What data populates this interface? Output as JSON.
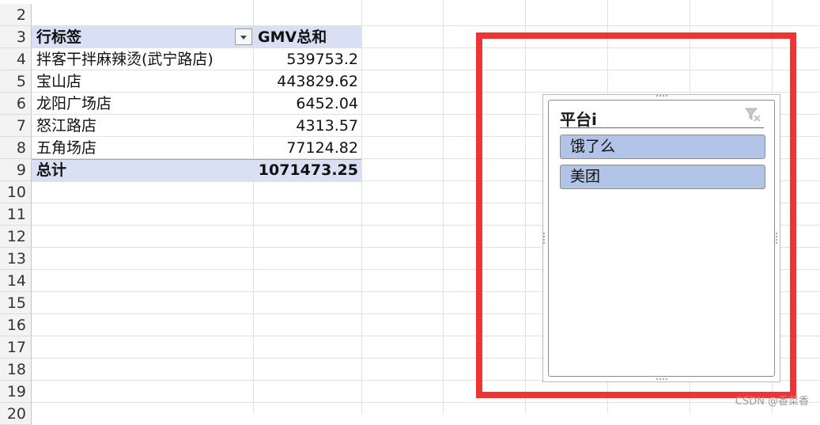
{
  "sheet": {
    "row_numbers": [
      "2",
      "3",
      "4",
      "5",
      "6",
      "7",
      "8",
      "9",
      "10",
      "11",
      "12",
      "13",
      "14",
      "15",
      "16",
      "17",
      "18",
      "19",
      "20"
    ]
  },
  "pivot": {
    "header_label": "行标签",
    "header_value": "GMV总和",
    "rows": [
      {
        "label": "拌客干拌麻辣烫(武宁路店)",
        "value": "539753.2"
      },
      {
        "label": "宝山店",
        "value": "443829.62"
      },
      {
        "label": "龙阳广场店",
        "value": "6452.04"
      },
      {
        "label": "怒江路店",
        "value": "4313.57"
      },
      {
        "label": "五角场店",
        "value": "77124.82"
      }
    ],
    "total_label": "总计",
    "total_value": "1071473.25",
    "filter_icon": "dropdown-filter-icon"
  },
  "slicer": {
    "title": "平台i",
    "clear_icon": "clear-filter-icon",
    "items": [
      "饿了么",
      "美团"
    ]
  },
  "colors": {
    "highlight_box": "#ee3434",
    "pivot_band": "#d9e0f3",
    "slicer_item": "#b1c4e8"
  },
  "watermark": "CSDN @香菜香"
}
